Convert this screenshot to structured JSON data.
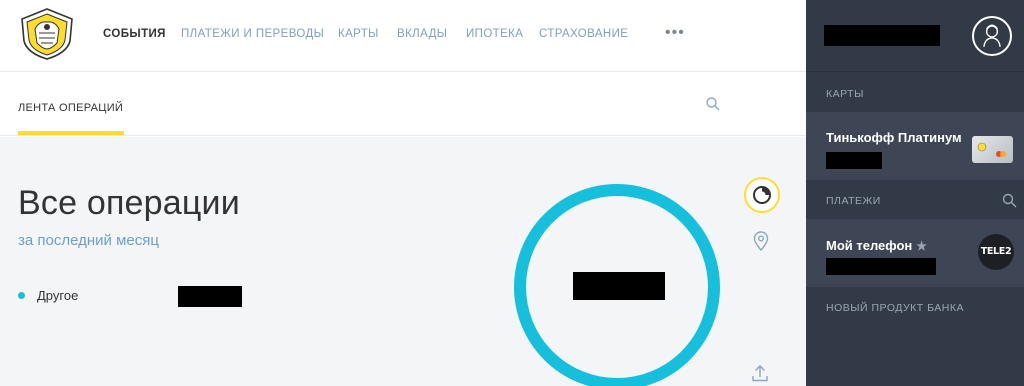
{
  "nav": {
    "items": [
      {
        "label": "СОБЫТИЯ",
        "active": true
      },
      {
        "label": "ПЛАТЕЖИ И ПЕРЕВОДЫ",
        "active": false
      },
      {
        "label": "КАРТЫ",
        "active": false
      },
      {
        "label": "ВКЛАДЫ",
        "active": false
      },
      {
        "label": "ИПОТЕКА",
        "active": false
      },
      {
        "label": "СТРАХОВАНИЕ",
        "active": false
      }
    ],
    "more": "•••"
  },
  "subnav": {
    "tab_label": "ЛЕНТА ОПЕРАЦИЙ"
  },
  "operations": {
    "title": "Все операции",
    "period": "за последний месяц",
    "legend": [
      {
        "label": "Другое",
        "color": "#16bfdc"
      }
    ]
  },
  "chart_data": {
    "type": "pie",
    "categories": [
      "Другое"
    ],
    "values": [
      100
    ],
    "colors": [
      "#16bfdc"
    ]
  },
  "panel": {
    "cards_label": "КАРТЫ",
    "card_name": "Тинькофф Платинум",
    "payments_label": "ПЛАТЕЖИ",
    "payment_name": "Мой телефон",
    "payment_star": "★",
    "operator_logo": "TELE2",
    "new_product_label": "НОВЫЙ ПРОДУКТ БАНКА"
  },
  "colors": {
    "accent_yellow": "#ffdd2d",
    "chart_cyan": "#16bfdc",
    "panel_bg": "#333a47",
    "link_blue": "#6e9fcc"
  },
  "icons": [
    "bank-logo-icon",
    "search-icon",
    "chart-icon",
    "location-pin-icon",
    "upload-icon",
    "user-avatar-icon",
    "card-icon",
    "operator-logo-icon"
  ]
}
